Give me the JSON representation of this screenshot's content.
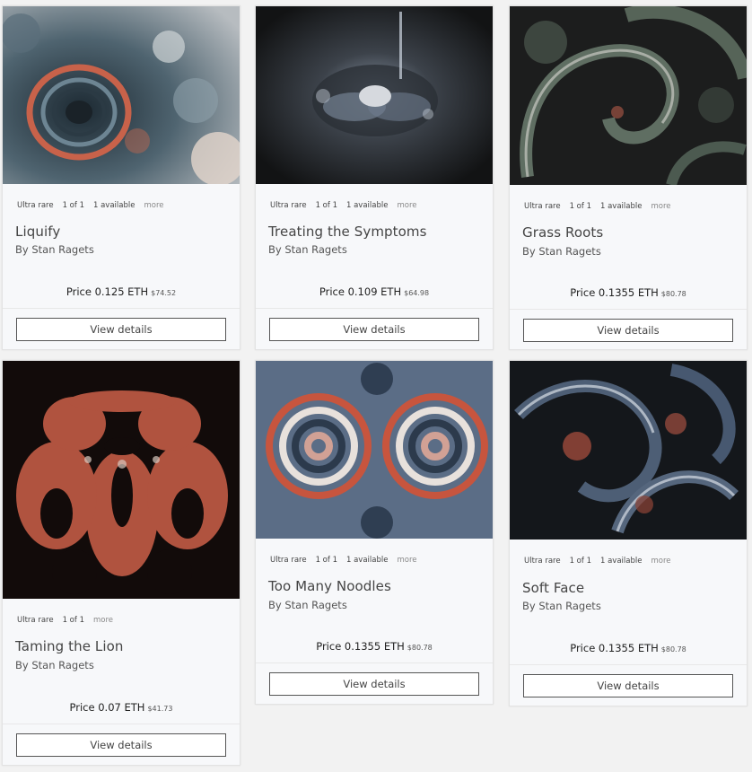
{
  "cards": [
    {
      "tags": [
        "Ultra rare",
        "1 of 1",
        "1 available",
        "more"
      ],
      "title": "Liquify",
      "artist": "By Stan Ragets",
      "price": "Price 0.125 ETH",
      "usd": "$74.52",
      "button": "View details"
    },
    {
      "tags": [
        "Ultra rare",
        "1 of 1",
        "1 available",
        "more"
      ],
      "title": "Treating the Symptoms",
      "artist": "By Stan Ragets",
      "price": "Price 0.109 ETH",
      "usd": "$64.98",
      "button": "View details"
    },
    {
      "tags": [
        "Ultra rare",
        "1 of 1",
        "1 available",
        "more"
      ],
      "title": "Grass Roots",
      "artist": "By Stan Ragets",
      "price": "Price 0.1355 ETH",
      "usd": "$80.78",
      "button": "View details"
    },
    {
      "tags": [
        "Ultra rare",
        "1 of 1",
        "more"
      ],
      "title": "Taming the Lion",
      "artist": "By Stan Ragets",
      "price": "Price 0.07 ETH",
      "usd": "$41.73",
      "button": "View details"
    },
    {
      "tags": [
        "Ultra rare",
        "1 of 1",
        "1 available",
        "more"
      ],
      "title": "Too Many Noodles",
      "artist": "By Stan Ragets",
      "price": "Price 0.1355 ETH",
      "usd": "$80.78",
      "button": "View details"
    },
    {
      "tags": [
        "Ultra rare",
        "1 of 1",
        "1 available",
        "more"
      ],
      "title": "Soft Face",
      "artist": "By Stan Ragets",
      "price": "Price 0.1355 ETH",
      "usd": "$80.78",
      "button": "View details"
    }
  ]
}
